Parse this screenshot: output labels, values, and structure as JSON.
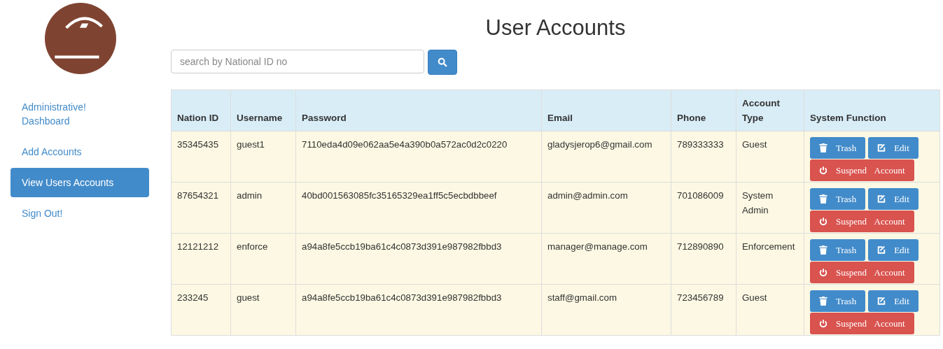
{
  "sidebar": {
    "items": [
      {
        "label": "Administrative! Dashboard",
        "selected": false
      },
      {
        "label": "Add Accounts",
        "selected": false
      },
      {
        "label": "View Users Accounts",
        "selected": true
      },
      {
        "label": "Sign Out!",
        "selected": false
      }
    ]
  },
  "title": "User Accounts",
  "search": {
    "placeholder": "search by National ID no"
  },
  "table": {
    "columns": [
      "Nation ID",
      "Username",
      "Password",
      "Email",
      "Phone",
      "Account Type",
      "System Function"
    ],
    "rows": [
      {
        "cells": [
          "35345435",
          "guest1",
          "7110eda4d09e062aa5e4a390b0a572ac0d2c0220",
          "gladysjerop6@gmail.com",
          "789333333",
          "Guest"
        ],
        "actions": [
          "Trash",
          "Edit",
          "Suspend Account"
        ]
      },
      {
        "cells": [
          "87654321",
          "admin",
          "40bd001563085fc35165329ea1ff5c5ecbdbbeef",
          "admin@admin.com",
          "701086009",
          "System Admin"
        ],
        "actions": [
          "Trash",
          "Edit",
          "Suspend Account"
        ]
      },
      {
        "cells": [
          "12121212",
          "enforce",
          "a94a8fe5ccb19ba61c4c0873d391e987982fbbd3",
          "manager@manage.com",
          "712890890",
          "Enforcement"
        ],
        "actions": [
          "Trash",
          "Edit",
          "Suspend Account"
        ]
      },
      {
        "cells": [
          "233245",
          "guest",
          "a94a8fe5ccb19ba61c4c0873d391e987982fbbd3",
          "staff@gmail.com",
          "723456789",
          "Guest"
        ],
        "actions": [
          "Trash",
          "Edit",
          "Suspend Account"
        ]
      }
    ]
  }
}
